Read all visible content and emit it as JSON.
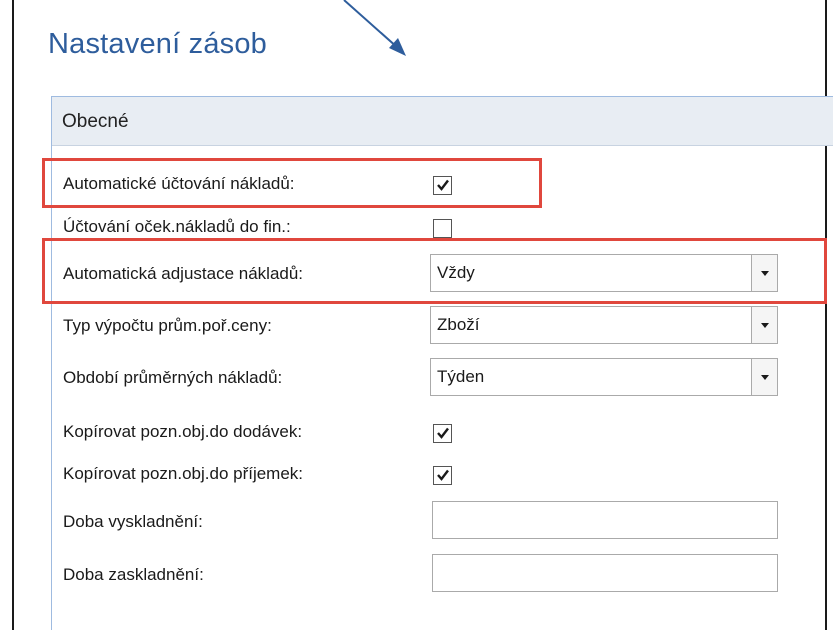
{
  "window": {
    "title": "Nastavení zásob"
  },
  "section": {
    "title": "Obecné"
  },
  "fields": {
    "automatic_cost_posting": {
      "label": "Automatické účtování nákladů:",
      "checked": true
    },
    "expected_cost_posting": {
      "label": "Účtování oček.nákladů do fin.:",
      "checked": false
    },
    "automatic_cost_adjustment": {
      "label": "Automatická adjustace nákladů:",
      "value": "Vždy"
    },
    "average_cost_calc_type": {
      "label": "Typ výpočtu prům.poř.ceny:",
      "value": "Zboží"
    },
    "average_cost_period": {
      "label": "Období průměrných nákladů:",
      "value": "Týden"
    },
    "copy_comments_to_shipments": {
      "label": "Kopírovat pozn.obj.do dodávek:",
      "checked": true
    },
    "copy_comments_to_receipts": {
      "label": "Kopírovat pozn.obj.do příjemek:",
      "checked": true
    },
    "outbound_whse_handling_time": {
      "label": "Doba vyskladnění:",
      "value": ""
    },
    "inbound_whse_handling_time": {
      "label": "Doba zaskladnění:",
      "value": ""
    }
  },
  "colors": {
    "title": "#2e5d9c",
    "highlight": "#e0473d",
    "arrow": "#2e5d9c",
    "panel_header": "#e8edf3"
  }
}
